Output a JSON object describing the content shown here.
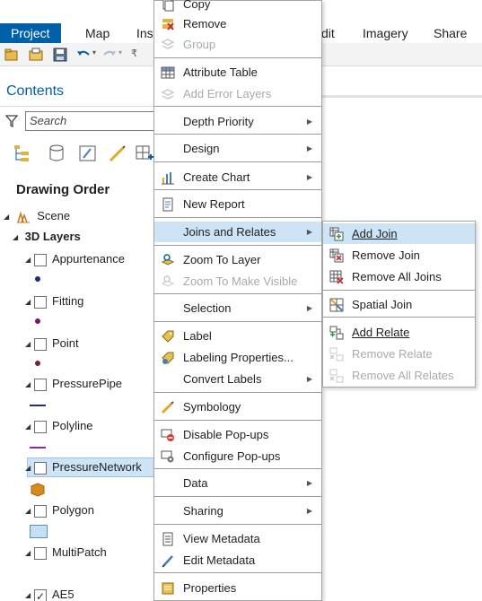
{
  "ribbon": {
    "tabs": [
      {
        "label": "Project",
        "active": true
      },
      {
        "label": "Map"
      },
      {
        "label": "Ins"
      },
      {
        "label": "dit"
      },
      {
        "label": "Imagery"
      },
      {
        "label": "Share"
      }
    ],
    "active_color": "#005fa9"
  },
  "contents": {
    "title": "Contents",
    "search_placeholder": "Search",
    "drawing_order": "Drawing Order",
    "scene": "Scene",
    "layers_3d": "3D Layers",
    "layers": [
      {
        "name": "Appurtenance",
        "symbol": "dot",
        "color": "#1d2a6b"
      },
      {
        "name": "Fitting",
        "symbol": "dot",
        "color": "#6a1a6e"
      },
      {
        "name": "Point",
        "symbol": "dot",
        "color": "#7a2131"
      },
      {
        "name": "PressurePipe",
        "symbol": "line",
        "color": "#1f2f8a"
      },
      {
        "name": "Polyline",
        "symbol": "line",
        "color": "#8a2aa0"
      },
      {
        "name": "PressureNetwork",
        "symbol": "box",
        "color": "#d88a1e",
        "selected": true
      },
      {
        "name": "Polygon",
        "symbol": "rect",
        "color": "#c5dff7"
      },
      {
        "name": "MultiPatch",
        "symbol": "none"
      },
      {
        "name": "AE5",
        "checked": true
      }
    ]
  },
  "menu": {
    "items": [
      {
        "label": "Copy",
        "icon": "copy-icon"
      },
      {
        "label": "Remove",
        "icon": "remove-icon"
      },
      {
        "label": "Group",
        "icon": "group-icon",
        "disabled": true
      },
      {
        "label": "Attribute Table",
        "icon": "table-icon"
      },
      {
        "label": "Add Error Layers",
        "icon": "error-layers-icon",
        "disabled": true
      },
      {
        "label": "Depth Priority",
        "submenu": true
      },
      {
        "label": "Design",
        "submenu": true
      },
      {
        "label": "Create Chart",
        "icon": "chart-icon",
        "submenu": true
      },
      {
        "label": "New Report",
        "icon": "report-icon"
      },
      {
        "label": "Joins and Relates",
        "submenu": true,
        "highlighted": true
      },
      {
        "label": "Zoom To Layer",
        "icon": "zoom-layer-icon"
      },
      {
        "label": "Zoom To Make Visible",
        "icon": "zoom-visible-icon",
        "disabled": true
      },
      {
        "label": "Selection",
        "submenu": true
      },
      {
        "label": "Label",
        "icon": "label-icon"
      },
      {
        "label": "Labeling Properties...",
        "icon": "labeling-properties-icon"
      },
      {
        "label": "Convert Labels",
        "submenu": true
      },
      {
        "label": "Symbology",
        "icon": "symbology-icon"
      },
      {
        "label": "Disable Pop-ups",
        "icon": "disable-popups-icon"
      },
      {
        "label": "Configure Pop-ups",
        "icon": "configure-popups-icon"
      },
      {
        "label": "Data",
        "submenu": true
      },
      {
        "label": "Sharing",
        "submenu": true
      },
      {
        "label": "View Metadata",
        "icon": "view-metadata-icon"
      },
      {
        "label": "Edit Metadata",
        "icon": "edit-metadata-icon"
      },
      {
        "label": "Properties",
        "icon": "properties-icon"
      }
    ]
  },
  "submenu": {
    "items": [
      {
        "label": "Add Join",
        "icon": "add-join-icon",
        "highlighted": true,
        "underline": "A"
      },
      {
        "label": "Remove Join",
        "icon": "remove-join-icon"
      },
      {
        "label": "Remove All Joins",
        "icon": "remove-all-joins-icon"
      },
      {
        "label": "Spatial Join",
        "icon": "spatial-join-icon"
      },
      {
        "label": "Add Relate",
        "icon": "add-relate-icon",
        "underline": "A"
      },
      {
        "label": "Remove Relate",
        "icon": "remove-relate-icon",
        "disabled": true
      },
      {
        "label": "Remove All Relates",
        "icon": "remove-all-relates-icon",
        "disabled": true
      }
    ]
  }
}
